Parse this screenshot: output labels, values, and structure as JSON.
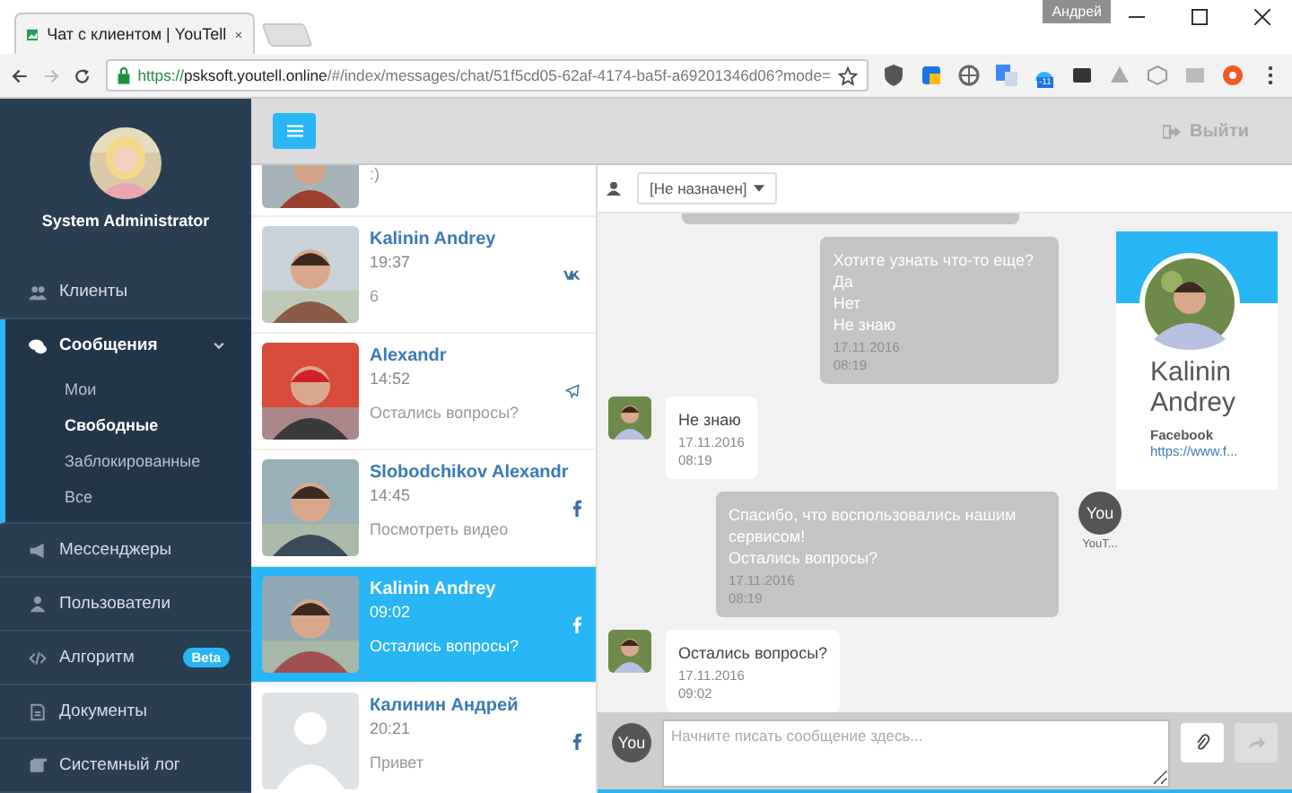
{
  "browser": {
    "tab_title": "Чат с клиентом | YouTell",
    "profile": "Андрей",
    "url": {
      "scheme": "https://",
      "host": "psksoft.youtell.online",
      "path": "/#/index/messages/chat/51f5cd05-62af-4174-ba5f-a69201346d06?mode="
    },
    "extension_badge": "-11"
  },
  "sidebar": {
    "user": "System Administrator",
    "menu": [
      {
        "label": "Клиенты"
      },
      {
        "label": "Сообщения",
        "expanded": true,
        "children": [
          {
            "label": "Мои",
            "selected": false
          },
          {
            "label": "Свободные",
            "selected": true
          },
          {
            "label": "Заблокированные",
            "selected": false
          },
          {
            "label": "Все",
            "selected": false
          }
        ]
      },
      {
        "label": "Мессенджеры"
      },
      {
        "label": "Пользователи"
      },
      {
        "label": "Алгоритм",
        "badge": "Beta"
      },
      {
        "label": "Документы"
      },
      {
        "label": "Системный лог"
      }
    ]
  },
  "topbar": {
    "logout": "Выйти"
  },
  "contacts_top": {
    "preview": ":)"
  },
  "contacts": [
    {
      "name": "Kalinin Andrey",
      "time": "19:37",
      "preview": "6",
      "kind": "vk",
      "selected": false,
      "no_photo": false
    },
    {
      "name": "Alexandr",
      "time": "14:52",
      "preview": "Остались вопросы?",
      "kind": "telegram",
      "selected": false,
      "no_photo": false
    },
    {
      "name": "Slobodchikov Alexandr",
      "time": "14:45",
      "preview": "Посмотреть видео",
      "kind": "facebook",
      "selected": false,
      "no_photo": false
    },
    {
      "name": "Kalinin Andrey",
      "time": "09:02",
      "preview": "Остались вопросы?",
      "kind": "facebook",
      "selected": true,
      "no_photo": false
    },
    {
      "name": "Калинин Андрей",
      "time": "20:21",
      "preview": "Привет",
      "kind": "facebook",
      "selected": false,
      "no_photo": true
    }
  ],
  "chat": {
    "assignee": "[Не назначен]",
    "messages": [
      {
        "kind": "out",
        "text": "Хотите узнать что-то еще?\nДа\nНет\nНе знаю",
        "date": "17.11.2016",
        "time": "08:19"
      },
      {
        "kind": "in",
        "text": "Не знаю",
        "date": "17.11.2016",
        "time": "08:19"
      },
      {
        "kind": "out",
        "text": "Спасибо, что воспользовались нашим сервисом!\nОстались вопросы?",
        "date": "17.11.2016",
        "time": "08:19",
        "avatar": "You",
        "sender": "YouT..."
      },
      {
        "kind": "in",
        "text": "Остались вопросы?",
        "date": "17.11.2016",
        "time": "09:02"
      }
    ],
    "profile": {
      "name": "Kalinin Andrey",
      "network": "Facebook",
      "link": "https://www.f..."
    },
    "composer": {
      "avatar": "You",
      "placeholder": "Начните писать сообщение здесь...",
      "send_disabled": true
    }
  }
}
